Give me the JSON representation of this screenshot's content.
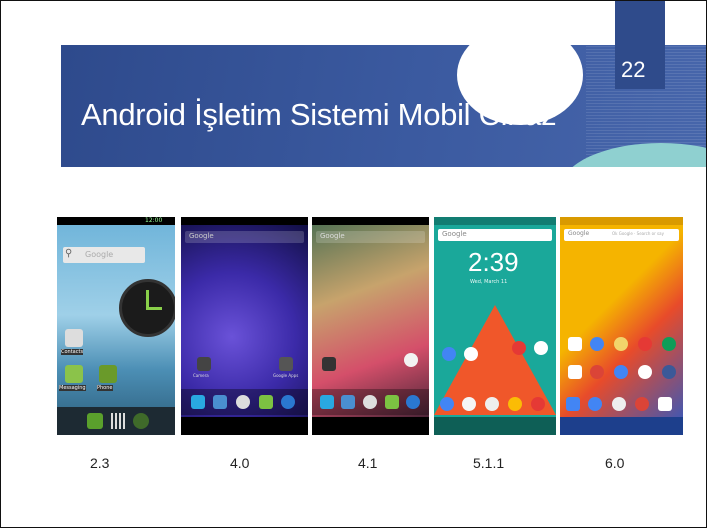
{
  "slide": {
    "title": "Android İşletim Sistemi Mobil Cihaz",
    "page_number": "22"
  },
  "screens": [
    {
      "version": "2.3",
      "search_text": "Google",
      "time": "12:00",
      "labels": [
        "Contacts",
        "Messaging",
        "Phone"
      ]
    },
    {
      "version": "4.0",
      "search_text": "Google",
      "labels": [
        "Camera",
        "Google Apps"
      ]
    },
    {
      "version": "4.1",
      "search_text": "Google"
    },
    {
      "version": "5.1.1",
      "search_text": "Google",
      "clock": "2:39",
      "date": "Wed, March 11"
    },
    {
      "version": "6.0",
      "search_text": "Google",
      "search_hint": "Ok Google · Search or say"
    }
  ],
  "colors": {
    "band": "#3b5aa0",
    "band_dark": "#2f4b8b",
    "teal": "#8fd0d0",
    "lollipop_teal": "#1aa89a",
    "lollipop_orange": "#f0572a",
    "marshmallow_yellow": "#f5b400"
  }
}
